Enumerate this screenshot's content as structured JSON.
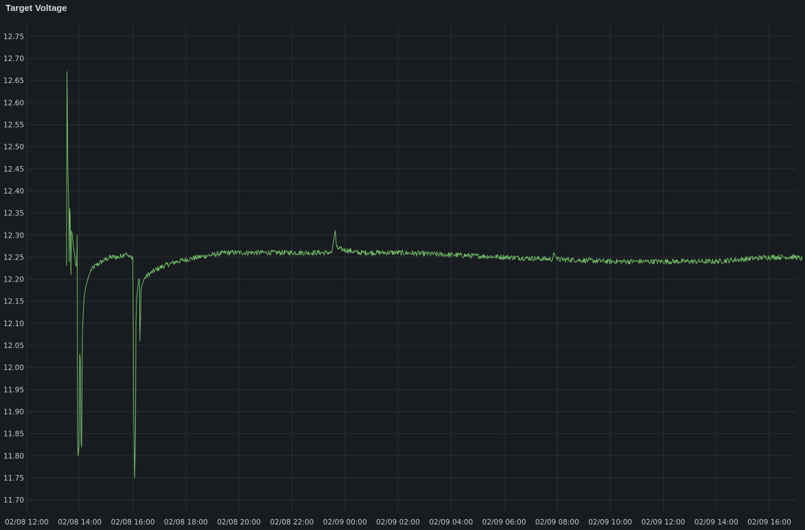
{
  "panel": {
    "title": "Target Voltage"
  },
  "colors": {
    "background": "#181b1f",
    "grid": "#2c2e33",
    "series": "#73bf69",
    "text": "#c7c7c9"
  },
  "chart_data": {
    "type": "line",
    "title": "Target Voltage",
    "xlabel": "",
    "ylabel": "",
    "grid": true,
    "legend": "none",
    "x_axis": {
      "type": "time",
      "range": [
        "02/08 12:00",
        "02/09 17:15"
      ],
      "ticks": [
        "02/08 12:00",
        "02/08 14:00",
        "02/08 16:00",
        "02/08 18:00",
        "02/08 20:00",
        "02/08 22:00",
        "02/09 00:00",
        "02/09 02:00",
        "02/09 04:00",
        "02/09 06:00",
        "02/09 08:00",
        "02/09 10:00",
        "02/09 12:00",
        "02/09 14:00",
        "02/09 16:00"
      ]
    },
    "y_axis": {
      "range": [
        11.68,
        12.77
      ],
      "ticks": [
        "11.70",
        "11.75",
        "11.80",
        "11.85",
        "11.90",
        "11.95",
        "12.00",
        "12.05",
        "12.10",
        "12.15",
        "12.20",
        "12.25",
        "12.30",
        "12.35",
        "12.40",
        "12.45",
        "12.50",
        "12.55",
        "12.60",
        "12.65",
        "12.70",
        "12.75"
      ]
    },
    "series": [
      {
        "color": "#73bf69",
        "points": [
          [
            "02/08 13:30",
            12.23
          ],
          [
            "02/08 13:31",
            12.67
          ],
          [
            "02/08 13:33",
            12.45
          ],
          [
            "02/08 13:35",
            12.37
          ],
          [
            "02/08 13:36",
            12.24
          ],
          [
            "02/08 13:37",
            12.36
          ],
          [
            "02/08 13:38",
            12.35
          ],
          [
            "02/08 13:40",
            12.21
          ],
          [
            "02/08 13:41",
            12.31
          ],
          [
            "02/08 13:43",
            12.3
          ],
          [
            "02/08 13:46",
            12.27
          ],
          [
            "02/08 13:49",
            12.25
          ],
          [
            "02/08 13:51",
            12.23
          ],
          [
            "02/08 13:53",
            12.23
          ],
          [
            "02/08 13:54",
            12.3
          ],
          [
            "02/08 13:55",
            11.85
          ],
          [
            "02/08 13:56",
            11.8
          ],
          [
            "02/08 13:58",
            11.82
          ],
          [
            "02/08 13:59",
            11.95
          ],
          [
            "02/08 14:00",
            12.03
          ],
          [
            "02/08 14:01",
            12.02
          ],
          [
            "02/08 14:03",
            11.83
          ],
          [
            "02/08 14:04",
            11.82
          ],
          [
            "02/08 14:05",
            11.95
          ],
          [
            "02/08 14:06",
            12.08
          ],
          [
            "02/08 14:08",
            12.13
          ],
          [
            "02/08 14:10",
            12.16
          ],
          [
            "02/08 14:13",
            12.18
          ],
          [
            "02/08 14:18",
            12.2
          ],
          [
            "02/08 14:25",
            12.22
          ],
          [
            "02/08 14:35",
            12.23
          ],
          [
            "02/08 14:50",
            12.24
          ],
          [
            "02/08 15:10",
            12.25
          ],
          [
            "02/08 15:30",
            12.25
          ],
          [
            "02/08 15:45",
            12.26
          ],
          [
            "02/08 15:50",
            12.25
          ],
          [
            "02/08 16:00",
            12.25
          ],
          [
            "02/08 16:02",
            11.9
          ],
          [
            "02/08 16:04",
            11.75
          ],
          [
            "02/08 16:06",
            11.84
          ],
          [
            "02/08 16:07",
            12.1
          ],
          [
            "02/08 16:09",
            12.16
          ],
          [
            "02/08 16:11",
            12.18
          ],
          [
            "02/08 16:13",
            12.2
          ],
          [
            "02/08 16:15",
            12.2
          ],
          [
            "02/08 16:16",
            12.06
          ],
          [
            "02/08 16:17",
            12.1
          ],
          [
            "02/08 16:19",
            12.18
          ],
          [
            "02/08 16:25",
            12.2
          ],
          [
            "02/08 16:35",
            12.21
          ],
          [
            "02/08 16:50",
            12.22
          ],
          [
            "02/08 17:10",
            12.23
          ],
          [
            "02/08 17:40",
            12.24
          ],
          [
            "02/08 18:30",
            12.25
          ],
          [
            "02/08 19:30",
            12.26
          ],
          [
            "02/08 21:00",
            12.26
          ],
          [
            "02/08 22:30",
            12.26
          ],
          [
            "02/08 23:30",
            12.26
          ],
          [
            "02/08 23:38",
            12.31
          ],
          [
            "02/08 23:41",
            12.27
          ],
          [
            "02/09 00:30",
            12.26
          ],
          [
            "02/09 02:00",
            12.26
          ],
          [
            "02/09 04:00",
            12.255
          ],
          [
            "02/09 06:00",
            12.25
          ],
          [
            "02/09 07:50",
            12.245
          ],
          [
            "02/09 07:52",
            12.26
          ],
          [
            "02/09 08:00",
            12.245
          ],
          [
            "02/09 10:00",
            12.24
          ],
          [
            "02/09 12:00",
            12.24
          ],
          [
            "02/09 14:00",
            12.24
          ],
          [
            "02/09 15:00",
            12.245
          ],
          [
            "02/09 16:00",
            12.25
          ],
          [
            "02/09 17:00",
            12.25
          ],
          [
            "02/09 17:15",
            12.245
          ]
        ]
      }
    ]
  }
}
